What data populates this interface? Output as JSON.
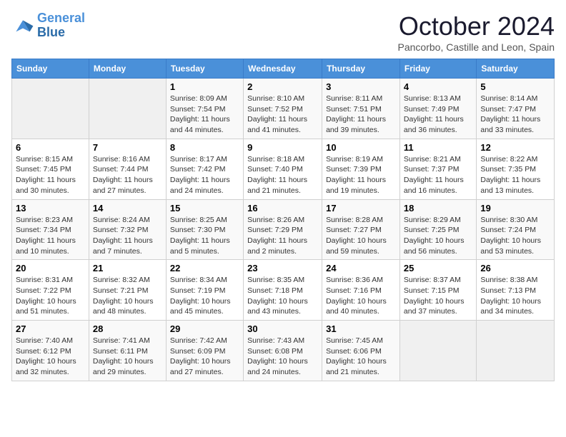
{
  "logo": {
    "line1": "General",
    "line2": "Blue"
  },
  "title": "October 2024",
  "subtitle": "Pancorbo, Castille and Leon, Spain",
  "days_of_week": [
    "Sunday",
    "Monday",
    "Tuesday",
    "Wednesday",
    "Thursday",
    "Friday",
    "Saturday"
  ],
  "weeks": [
    [
      {
        "day": "",
        "info": ""
      },
      {
        "day": "",
        "info": ""
      },
      {
        "day": "1",
        "info": "Sunrise: 8:09 AM\nSunset: 7:54 PM\nDaylight: 11 hours and 44 minutes."
      },
      {
        "day": "2",
        "info": "Sunrise: 8:10 AM\nSunset: 7:52 PM\nDaylight: 11 hours and 41 minutes."
      },
      {
        "day": "3",
        "info": "Sunrise: 8:11 AM\nSunset: 7:51 PM\nDaylight: 11 hours and 39 minutes."
      },
      {
        "day": "4",
        "info": "Sunrise: 8:13 AM\nSunset: 7:49 PM\nDaylight: 11 hours and 36 minutes."
      },
      {
        "day": "5",
        "info": "Sunrise: 8:14 AM\nSunset: 7:47 PM\nDaylight: 11 hours and 33 minutes."
      }
    ],
    [
      {
        "day": "6",
        "info": "Sunrise: 8:15 AM\nSunset: 7:45 PM\nDaylight: 11 hours and 30 minutes."
      },
      {
        "day": "7",
        "info": "Sunrise: 8:16 AM\nSunset: 7:44 PM\nDaylight: 11 hours and 27 minutes."
      },
      {
        "day": "8",
        "info": "Sunrise: 8:17 AM\nSunset: 7:42 PM\nDaylight: 11 hours and 24 minutes."
      },
      {
        "day": "9",
        "info": "Sunrise: 8:18 AM\nSunset: 7:40 PM\nDaylight: 11 hours and 21 minutes."
      },
      {
        "day": "10",
        "info": "Sunrise: 8:19 AM\nSunset: 7:39 PM\nDaylight: 11 hours and 19 minutes."
      },
      {
        "day": "11",
        "info": "Sunrise: 8:21 AM\nSunset: 7:37 PM\nDaylight: 11 hours and 16 minutes."
      },
      {
        "day": "12",
        "info": "Sunrise: 8:22 AM\nSunset: 7:35 PM\nDaylight: 11 hours and 13 minutes."
      }
    ],
    [
      {
        "day": "13",
        "info": "Sunrise: 8:23 AM\nSunset: 7:34 PM\nDaylight: 11 hours and 10 minutes."
      },
      {
        "day": "14",
        "info": "Sunrise: 8:24 AM\nSunset: 7:32 PM\nDaylight: 11 hours and 7 minutes."
      },
      {
        "day": "15",
        "info": "Sunrise: 8:25 AM\nSunset: 7:30 PM\nDaylight: 11 hours and 5 minutes."
      },
      {
        "day": "16",
        "info": "Sunrise: 8:26 AM\nSunset: 7:29 PM\nDaylight: 11 hours and 2 minutes."
      },
      {
        "day": "17",
        "info": "Sunrise: 8:28 AM\nSunset: 7:27 PM\nDaylight: 10 hours and 59 minutes."
      },
      {
        "day": "18",
        "info": "Sunrise: 8:29 AM\nSunset: 7:25 PM\nDaylight: 10 hours and 56 minutes."
      },
      {
        "day": "19",
        "info": "Sunrise: 8:30 AM\nSunset: 7:24 PM\nDaylight: 10 hours and 53 minutes."
      }
    ],
    [
      {
        "day": "20",
        "info": "Sunrise: 8:31 AM\nSunset: 7:22 PM\nDaylight: 10 hours and 51 minutes."
      },
      {
        "day": "21",
        "info": "Sunrise: 8:32 AM\nSunset: 7:21 PM\nDaylight: 10 hours and 48 minutes."
      },
      {
        "day": "22",
        "info": "Sunrise: 8:34 AM\nSunset: 7:19 PM\nDaylight: 10 hours and 45 minutes."
      },
      {
        "day": "23",
        "info": "Sunrise: 8:35 AM\nSunset: 7:18 PM\nDaylight: 10 hours and 43 minutes."
      },
      {
        "day": "24",
        "info": "Sunrise: 8:36 AM\nSunset: 7:16 PM\nDaylight: 10 hours and 40 minutes."
      },
      {
        "day": "25",
        "info": "Sunrise: 8:37 AM\nSunset: 7:15 PM\nDaylight: 10 hours and 37 minutes."
      },
      {
        "day": "26",
        "info": "Sunrise: 8:38 AM\nSunset: 7:13 PM\nDaylight: 10 hours and 34 minutes."
      }
    ],
    [
      {
        "day": "27",
        "info": "Sunrise: 7:40 AM\nSunset: 6:12 PM\nDaylight: 10 hours and 32 minutes."
      },
      {
        "day": "28",
        "info": "Sunrise: 7:41 AM\nSunset: 6:11 PM\nDaylight: 10 hours and 29 minutes."
      },
      {
        "day": "29",
        "info": "Sunrise: 7:42 AM\nSunset: 6:09 PM\nDaylight: 10 hours and 27 minutes."
      },
      {
        "day": "30",
        "info": "Sunrise: 7:43 AM\nSunset: 6:08 PM\nDaylight: 10 hours and 24 minutes."
      },
      {
        "day": "31",
        "info": "Sunrise: 7:45 AM\nSunset: 6:06 PM\nDaylight: 10 hours and 21 minutes."
      },
      {
        "day": "",
        "info": ""
      },
      {
        "day": "",
        "info": ""
      }
    ]
  ]
}
